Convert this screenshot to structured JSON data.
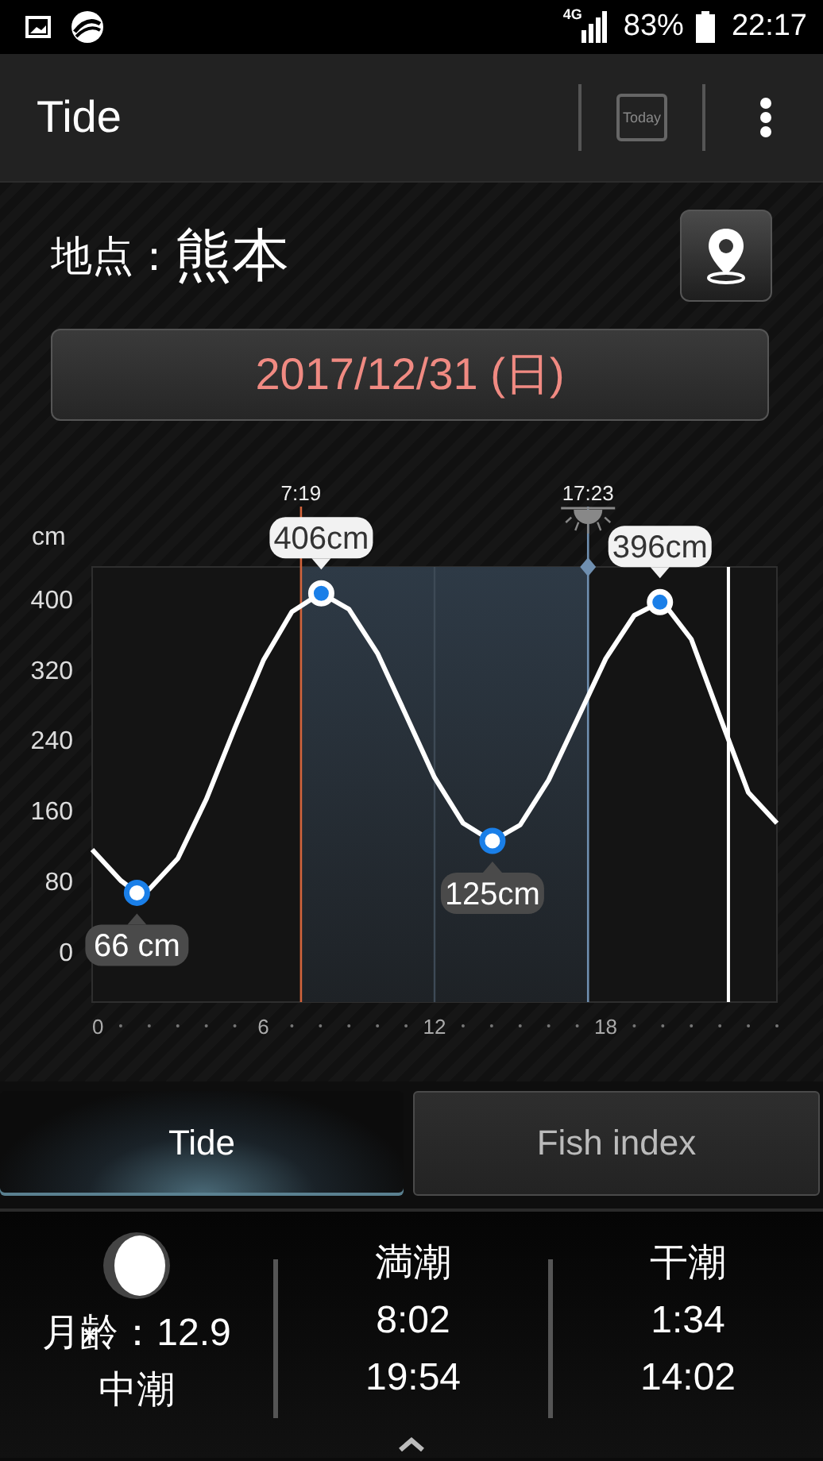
{
  "status_bar": {
    "network": "4G",
    "battery": "83%",
    "time": "22:17"
  },
  "app_bar": {
    "title": "Tide",
    "today_button": "Today"
  },
  "location": {
    "label": "地点：",
    "name": "熊本"
  },
  "date_button": "2017/12/31 (日)",
  "chart": {
    "chart_data": {
      "type": "line",
      "ylabel": "cm",
      "x": [
        0,
        1,
        1.57,
        2,
        3,
        4,
        5,
        6,
        7,
        8,
        8.03,
        9,
        10,
        11,
        12,
        13,
        14,
        14.03,
        15,
        16,
        17,
        18,
        19,
        19.9,
        20,
        21,
        22,
        23,
        24
      ],
      "series": [
        {
          "color": "#ffffff",
          "values": [
            115,
            80,
            66,
            70,
            105,
            172,
            253,
            330,
            385,
            406,
            406,
            388,
            338,
            268,
            197,
            145,
            125,
            125,
            143,
            194,
            263,
            332,
            381,
            396,
            396,
            354,
            266,
            180,
            145
          ]
        }
      ],
      "xlim": [
        0,
        24
      ],
      "ylim": [
        -58,
        436
      ],
      "xticks": [
        0,
        6,
        12,
        18
      ],
      "yticks": [
        0,
        80,
        160,
        240,
        320,
        400
      ],
      "bands": [
        {
          "axis": "x",
          "from": 7.32,
          "to": 17.38,
          "color": "#2e3a46"
        }
      ],
      "ref_lines": [
        {
          "axis": "x",
          "value": 7.32,
          "label": "7:19",
          "color": "#d2643c"
        },
        {
          "axis": "x",
          "value": 17.38,
          "label": "17:23",
          "color": "#6f8fb0"
        },
        {
          "axis": "x",
          "value": 12,
          "color": "#3e4a56"
        },
        {
          "axis": "x",
          "value": 22.3,
          "color": "#ffffff"
        }
      ],
      "annotations": [
        {
          "x": 1.57,
          "y": 66,
          "text": "66 cm"
        },
        {
          "x": 8.03,
          "y": 406,
          "text": "406cm"
        },
        {
          "x": 14.03,
          "y": 125,
          "text": "125cm"
        },
        {
          "x": 19.9,
          "y": 396,
          "text": "396cm"
        }
      ]
    }
  },
  "tabs": [
    {
      "label": "Tide",
      "selected": true
    },
    {
      "label": "Fish index",
      "selected": false
    }
  ],
  "summary": {
    "moon_age": "月齢：12.9",
    "tide_type": "中潮",
    "columns": [
      {
        "heading": "満潮",
        "times": [
          "8:02",
          "19:54"
        ]
      },
      {
        "heading": "干潮",
        "times": [
          "1:34",
          "14:02"
        ]
      }
    ]
  }
}
